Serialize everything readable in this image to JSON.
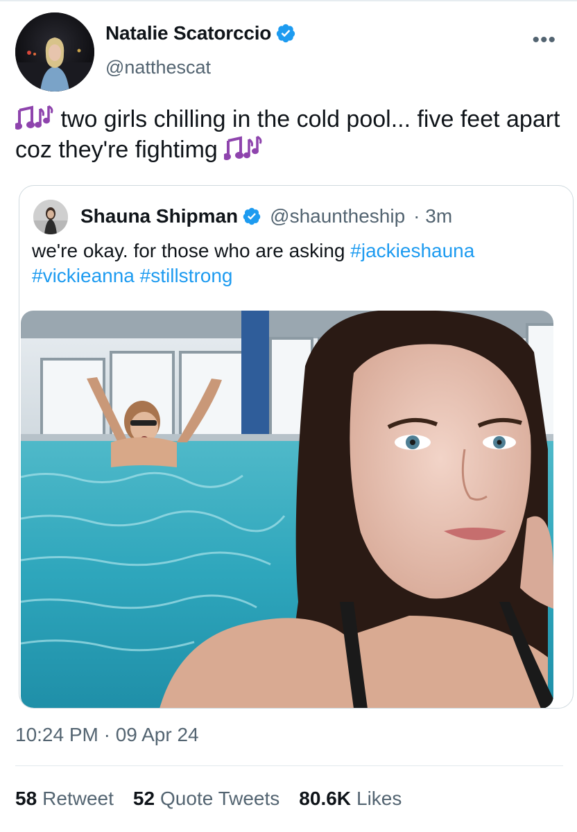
{
  "author": {
    "display_name": "Natalie Scatorccio",
    "handle": "@natthescat"
  },
  "tweet": {
    "text": "two girls chilling in the cold pool... five feet apart coz they're fightimg",
    "emoji": "musical-notes"
  },
  "quoted": {
    "display_name": "Shauna Shipman",
    "handle": "@shauntheship",
    "time": "· 3m",
    "text": "we're okay. for those who are asking",
    "hashtags": [
      "#jackieshauna",
      "#vickieanna",
      "#stillstrong"
    ]
  },
  "meta": {
    "timestamp": "10:24 PM · 09 Apr 24"
  },
  "stats": {
    "retweets_count": "58",
    "retweets_label": "Retweet",
    "quotes_count": "52",
    "quotes_label": "Quote Tweets",
    "likes_count": "80.6K",
    "likes_label": "Likes"
  },
  "colors": {
    "verified": "#1d9bf0",
    "hashtag": "#1d9bf0",
    "music_note": "#8e44ad"
  },
  "icons": [
    "verified-badge-icon",
    "more-options-icon",
    "musical-notes-icon"
  ]
}
